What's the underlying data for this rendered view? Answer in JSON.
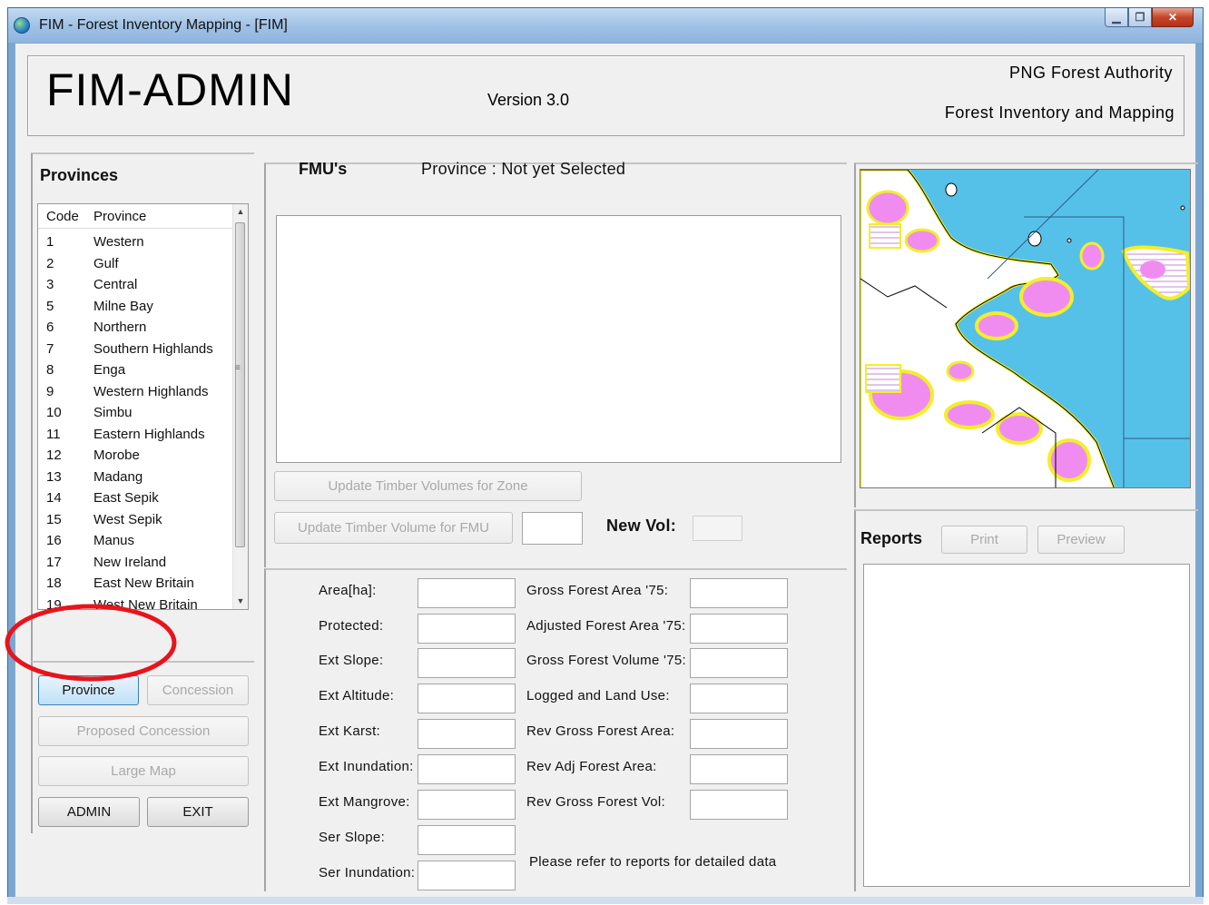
{
  "window": {
    "title": "FIM - Forest Inventory Mapping - [FIM]",
    "controls": [
      "▁",
      "❐",
      "✕"
    ]
  },
  "header": {
    "app_title": "FIM-ADMIN",
    "version": "Version 3.0",
    "org_line1": "PNG Forest Authority",
    "org_line2": "Forest Inventory and Mapping"
  },
  "provinces": {
    "title": "Provinces",
    "columns": [
      "Code",
      "Province"
    ],
    "rows": [
      {
        "code": "1",
        "name": "Western"
      },
      {
        "code": "2",
        "name": "Gulf"
      },
      {
        "code": "3",
        "name": "Central"
      },
      {
        "code": "5",
        "name": "Milne Bay"
      },
      {
        "code": "6",
        "name": "Northern"
      },
      {
        "code": "7",
        "name": "Southern Highlands"
      },
      {
        "code": "8",
        "name": "Enga"
      },
      {
        "code": "9",
        "name": "Western Highlands"
      },
      {
        "code": "10",
        "name": "Simbu"
      },
      {
        "code": "11",
        "name": "Eastern Highlands"
      },
      {
        "code": "12",
        "name": "Morobe"
      },
      {
        "code": "13",
        "name": "Madang"
      },
      {
        "code": "14",
        "name": "East Sepik"
      },
      {
        "code": "15",
        "name": "West Sepik"
      },
      {
        "code": "16",
        "name": "Manus"
      },
      {
        "code": "17",
        "name": "New Ireland"
      },
      {
        "code": "18",
        "name": "East New Britain"
      },
      {
        "code": "19",
        "name": "West New Britain"
      }
    ]
  },
  "nav_buttons": {
    "province": "Province",
    "concession": "Concession",
    "proposed_concession": "Proposed Concession",
    "large_map": "Large Map",
    "admin": "ADMIN",
    "exit": "EXIT"
  },
  "fmu": {
    "title": "FMU's",
    "province_status": "Province : Not yet Selected",
    "update_zone_button": "Update Timber Volumes for Zone",
    "update_fmu_button": "Update Timber Volume for FMU",
    "new_vol_label": "New Vol:"
  },
  "stats": {
    "left_labels": [
      "Area[ha]:",
      "Protected:",
      "Ext Slope:",
      "Ext Altitude:",
      "Ext Karst:",
      "Ext Inundation:",
      "Ext Mangrove:",
      "Ser Slope:",
      "Ser Inundation:"
    ],
    "right_labels": [
      "Gross Forest Area '75:",
      "Adjusted Forest Area '75:",
      "Gross Forest Volume '75:",
      "Logged and Land Use:",
      "Rev Gross Forest Area:",
      "Rev Adj Forest Area:",
      "Rev Gross Forest Vol:"
    ],
    "note": "Please refer to reports for detailed data"
  },
  "reports": {
    "title": "Reports",
    "print_button": "Print",
    "preview_button": "Preview"
  },
  "colors": {
    "sea": "#56c1e8",
    "land": "#ffffff",
    "forest_outline": "#f2ee2a",
    "forest_fill": "#f08cf0",
    "annotation": "#e8141c",
    "focused_button": "#bfe1f8"
  }
}
